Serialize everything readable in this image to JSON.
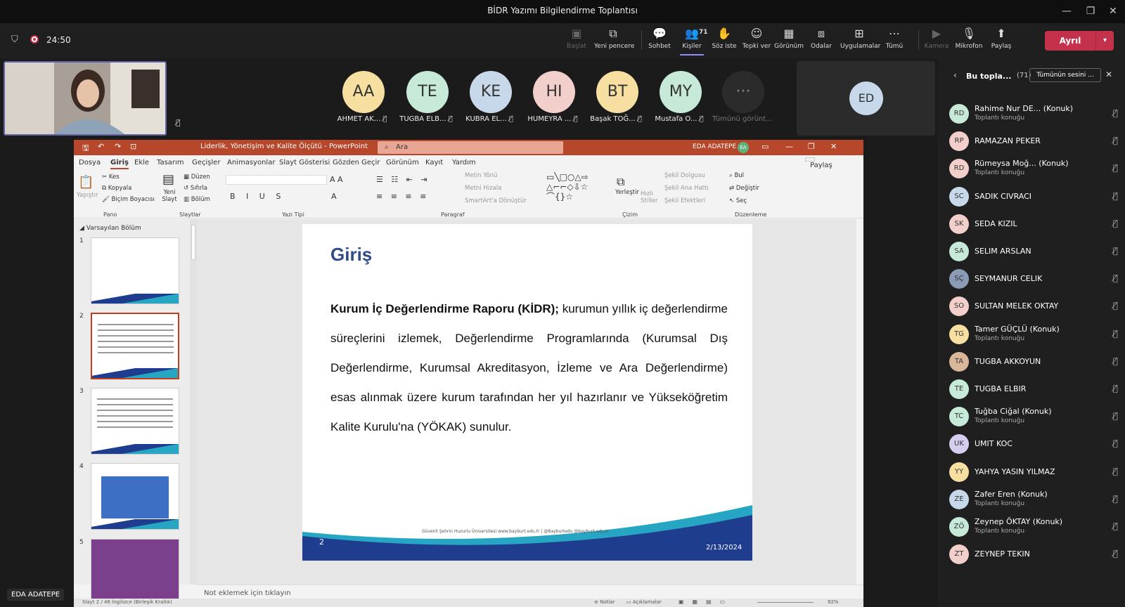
{
  "window": {
    "title": "BİDR Yazımı Bilgilendirme Toplantısı",
    "min": "—",
    "restore": "❐",
    "close": "✕"
  },
  "meeting": {
    "timer": "24:50",
    "people_count": "71",
    "toolbar": [
      {
        "label": "Başlat",
        "icon": "▣",
        "disabled": true
      },
      {
        "label": "Yeni pencere",
        "icon": "⧉"
      },
      {
        "label": "Sohbet",
        "icon": "💬"
      },
      {
        "label": "Kişiler",
        "icon": "👥",
        "active": true
      },
      {
        "label": "Söz iste",
        "icon": "✋"
      },
      {
        "label": "Tepki ver",
        "icon": "☺"
      },
      {
        "label": "Görünüm",
        "icon": "▦"
      },
      {
        "label": "Odalar",
        "icon": "⧈"
      },
      {
        "label": "Uygulamalar",
        "icon": "⊞"
      },
      {
        "label": "Tümü",
        "icon": "⋯"
      },
      {
        "label": "Kamera",
        "icon": "▶",
        "disabled": true
      },
      {
        "label": "Mikrofon",
        "icon": "🎙"
      },
      {
        "label": "Paylaş",
        "icon": "⬆"
      }
    ],
    "leave_label": "Ayrıl",
    "leave_color": "#c4314b"
  },
  "participants_strip": [
    {
      "initials": "AA",
      "name": "AHMET AK...",
      "color": "#f6dfa0"
    },
    {
      "initials": "TE",
      "name": "TUGBA ELB...",
      "color": "#c6ead7"
    },
    {
      "initials": "KE",
      "name": "KUBRA EL...",
      "color": "#c7d8ea"
    },
    {
      "initials": "HI",
      "name": "HUMEYRA ...",
      "color": "#f3cfcb"
    },
    {
      "initials": "BT",
      "name": "Başak TOĞ...",
      "color": "#f6dfa0"
    },
    {
      "initials": "MY",
      "name": "Mustafa O...",
      "color": "#c6ead7"
    },
    {
      "initials": "···",
      "name": "Tümünü görünt...",
      "color": "#2b2b2b"
    }
  ],
  "ed_tile": {
    "initials": "ED"
  },
  "presenter_label": "EDA ADATEPE",
  "powerpoint": {
    "doc_title": "Liderlik, Yönetişim ve Kalite Ölçütü  -  PowerPoint",
    "search_placeholder": "Ara",
    "user": "EDA ADATEPE",
    "user_initials": "EA",
    "share": "Paylaş",
    "menus": [
      "Dosya",
      "Giriş",
      "Ekle",
      "Tasarım",
      "Geçişler",
      "Animasyonlar",
      "Slayt Gösterisi",
      "Gözden Geçir",
      "Görünüm",
      "Kayıt",
      "Yardım"
    ],
    "ribbon_groups": [
      "Pano",
      "Slaytlar",
      "Yazı Tipi",
      "Paragraf",
      "Çizim",
      "Düzenleme"
    ],
    "ribbon": {
      "paste": "Yapıştır",
      "cut": "Kes",
      "copy": "Kopyala",
      "format_painter": "Biçim Boyacısı",
      "new_slide": "Yeni Slayt",
      "layout": "Düzen",
      "reset": "Sıfırla",
      "section": "Bölüm",
      "text_dir": "Metin Yönü",
      "align_text": "Metni Hizala",
      "smartart": "SmartArt'a Dönüştür",
      "arrange": "Yerleştir",
      "quick_styles": "Hızlı Stiller",
      "shape_fill": "Şekil Dolgusu",
      "shape_outline": "Şekil Ana Hattı",
      "shape_effects": "Şekil Efektleri",
      "find": "Bul",
      "replace": "Değiştir",
      "select": "Seç"
    },
    "section_name": "Varsayılan Bölüm",
    "thumbs": [
      "1",
      "2",
      "3",
      "4",
      "5"
    ],
    "slide": {
      "title": "Giriş",
      "number": "2",
      "date": "2/13/2024",
      "footer": "Güvenli Şehrin Huzurlu Üniversitesi  www.bayburt.edu.tr  |  @Bayburtedu  @bayburt.edu.tr",
      "body_bold": "Kurum İç Değerlendirme Raporu (KİDR);",
      "body_rest": " kurumun yıllık iç değerlendirme süreçlerini izlemek, Değerlendirme Programlarında (Kurumsal Dış Değerlendirme, Kurumsal Akreditasyon, İzleme ve Ara Değerlendirme) esas alınmak üzere kurum tarafından her yıl hazırlanır ve Yükseköğretim Kalite Kurulu'na (YÖKAK) sunulur."
    },
    "notes_placeholder": "Not eklemek için tıklayın",
    "status_left": "Slayt 2 / 46    İngilizce (Birleşik Krallık)",
    "status_notes": "Notlar",
    "status_comments": "Açıklamalar",
    "zoom": "92%"
  },
  "panel": {
    "title": "Bu topla...",
    "count": "(71)",
    "mute_all": "Tümünün sesini ...",
    "people": [
      {
        "initials": "RD",
        "name": "Rahime Nur DE... (Konuk)",
        "sub": "Toplantı konuğu",
        "color": "#c6ead7"
      },
      {
        "initials": "RP",
        "name": "RAMAZAN PEKER",
        "sub": "",
        "color": "#f3cfcb"
      },
      {
        "initials": "RD",
        "name": "Rümeysa Moğ... (Konuk)",
        "sub": "Toplantı konuğu",
        "color": "#f3cfcb"
      },
      {
        "initials": "SC",
        "name": "SADIK CIVRACI",
        "sub": "",
        "color": "#c7d8ea"
      },
      {
        "initials": "SK",
        "name": "SEDA KIZIL",
        "sub": "",
        "color": "#f3cfcb"
      },
      {
        "initials": "SA",
        "name": "SELIM ARSLAN",
        "sub": "",
        "color": "#c6ead7"
      },
      {
        "initials": "SÇ",
        "name": "SEYMANUR CELIK",
        "sub": "",
        "color": "#8a9bb5"
      },
      {
        "initials": "SO",
        "name": "SULTAN MELEK OKTAY",
        "sub": "",
        "color": "#f3cfcb"
      },
      {
        "initials": "TG",
        "name": "Tamer GÜÇLÜ (Konuk)",
        "sub": "Toplantı konuğu",
        "color": "#f6dfa0"
      },
      {
        "initials": "TA",
        "name": "TUGBA AKKOYUN",
        "sub": "",
        "color": "#d9b89a"
      },
      {
        "initials": "TE",
        "name": "TUGBA ELBIR",
        "sub": "",
        "color": "#c6ead7"
      },
      {
        "initials": "TC",
        "name": "Tuğba Ciğal (Konuk)",
        "sub": "Toplantı konuğu",
        "color": "#c6ead7"
      },
      {
        "initials": "UK",
        "name": "UMIT KOC",
        "sub": "",
        "color": "#d6cdef"
      },
      {
        "initials": "YY",
        "name": "YAHYA YASIN YILMAZ",
        "sub": "",
        "color": "#f6dfa0"
      },
      {
        "initials": "ZE",
        "name": "Zafer Eren (Konuk)",
        "sub": "Toplantı konuğu",
        "color": "#c7d8ea"
      },
      {
        "initials": "ZÖ",
        "name": "Zeynep ÖKTAY (Konuk)",
        "sub": "Toplantı konuğu",
        "color": "#c6ead7"
      },
      {
        "initials": "ZT",
        "name": "ZEYNEP TEKIN",
        "sub": "",
        "color": "#f3cfcb"
      }
    ]
  }
}
